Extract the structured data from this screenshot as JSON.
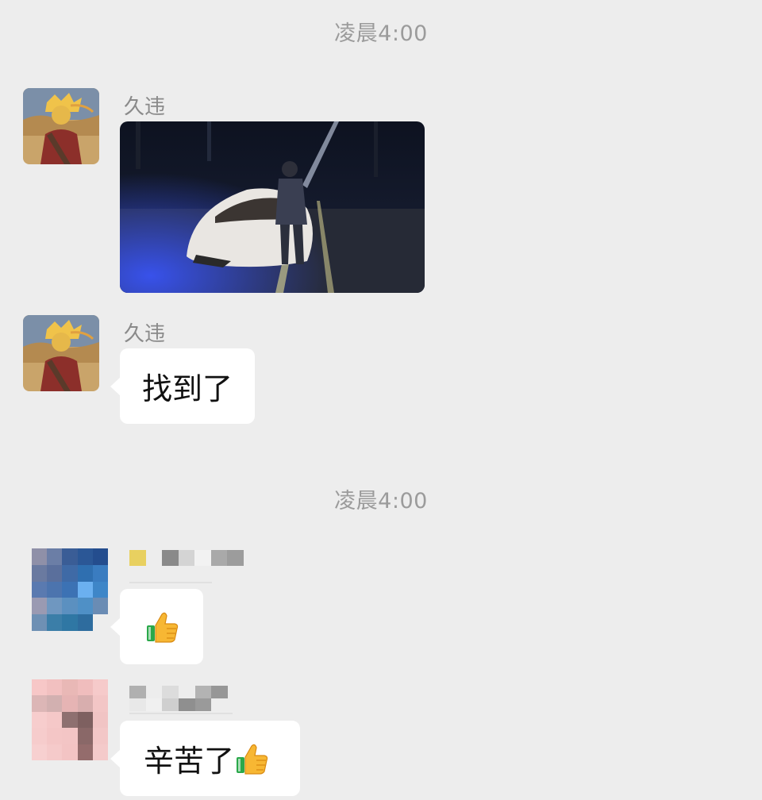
{
  "messages": [
    {
      "timestamp": "凌晨4:00",
      "sender": "久违",
      "kind": "image",
      "image_description": "night photo of a white sports car beside a standing person on a road"
    },
    {
      "sender": "久违",
      "kind": "text",
      "text": "找到了"
    },
    {
      "timestamp": "凌晨4:00",
      "sender": "",
      "sender_censored": true,
      "kind": "emoji",
      "emoji": "thumbs-up-icon"
    },
    {
      "sender": "",
      "sender_censored": true,
      "kind": "text",
      "text": "辛苦了",
      "emoji": "thumbs-up-icon"
    }
  ],
  "colors": {
    "background": "#ededed",
    "bubble": "#ffffff",
    "timestamp_text": "#9b9b9b",
    "name_text": "#8a8a8a"
  }
}
